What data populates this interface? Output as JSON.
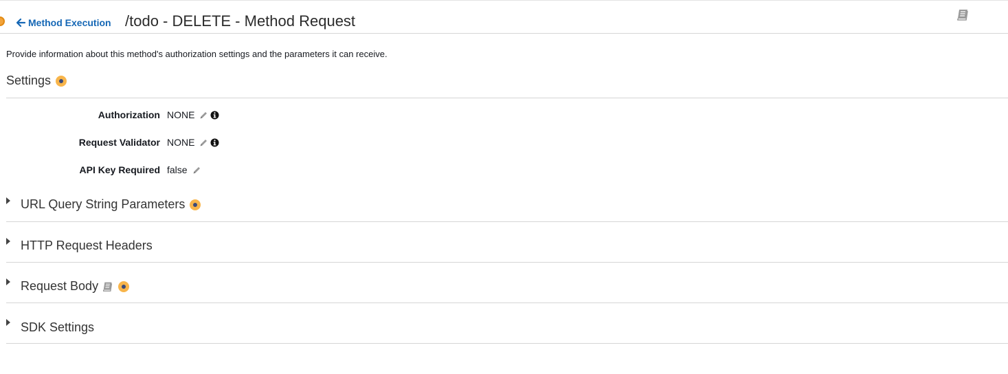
{
  "header": {
    "back_label": "Method Execution",
    "title": "/todo - DELETE - Method Request"
  },
  "intro_text": "Provide information about this method's authorization settings and the parameters it can receive.",
  "settings": {
    "title": "Settings",
    "rows": [
      {
        "label": "Authorization",
        "value": "NONE"
      },
      {
        "label": "Request Validator",
        "value": "NONE"
      },
      {
        "label": "API Key Required",
        "value": "false"
      }
    ]
  },
  "sections": [
    {
      "title": "URL Query String Parameters"
    },
    {
      "title": "HTTP Request Headers"
    },
    {
      "title": "Request Body"
    },
    {
      "title": "SDK Settings"
    }
  ],
  "colors": {
    "link": "#1567b5",
    "badge": "#f8b54b",
    "badge_center": "#3b4a7a",
    "rule": "#d5d5d5"
  },
  "icons": [
    "arrow-left-icon",
    "book-icon",
    "pencil-icon",
    "info-icon",
    "caret-right-icon",
    "status-badge-icon"
  ]
}
